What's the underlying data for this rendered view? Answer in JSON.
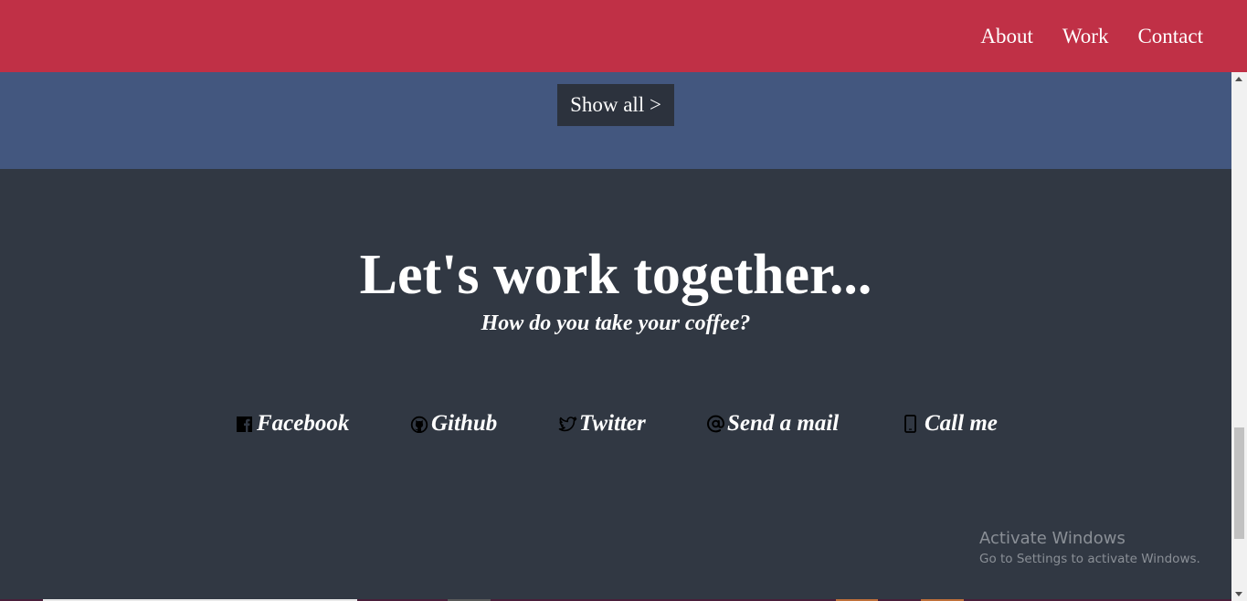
{
  "header": {
    "nav": [
      "About",
      "Work",
      "Contact"
    ],
    "background": "#c03046"
  },
  "work_section": {
    "show_all_label": "Show all >",
    "background": "#43577f"
  },
  "contact_section": {
    "title": "Let's work together...",
    "subtitle": "How do you take your coffee?",
    "background": "#313843",
    "links": [
      {
        "label": "Facebook",
        "icon": "facebook-icon"
      },
      {
        "label": "Github",
        "icon": "github-icon"
      },
      {
        "label": "Twitter",
        "icon": "twitter-icon"
      },
      {
        "label": "Send a mail",
        "icon": "at-icon"
      },
      {
        "label": "Call me",
        "icon": "phone-icon"
      }
    ]
  },
  "watermark": {
    "title": "Activate Windows",
    "subtitle": "Go to Settings to activate Windows."
  }
}
